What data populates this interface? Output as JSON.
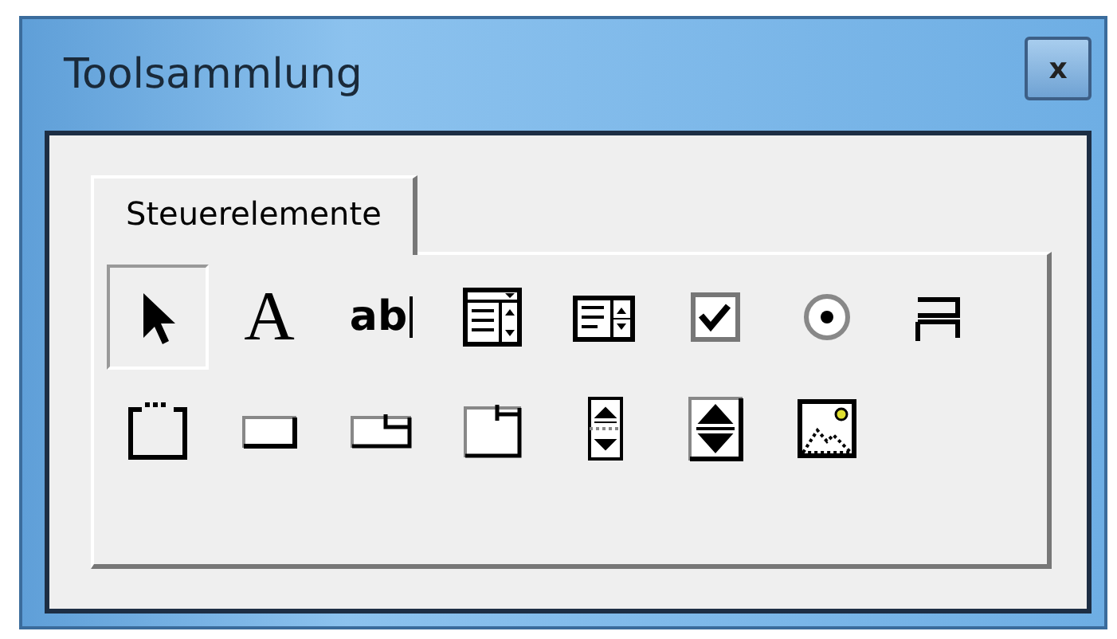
{
  "window": {
    "title": "Toolsammlung",
    "close": "x"
  },
  "tabs": [
    {
      "label": "Steuerelemente",
      "selected": true
    }
  ],
  "tool_rows": [
    [
      {
        "kind": "pointer",
        "selected": true
      },
      {
        "kind": "label",
        "glyph": "A",
        "selected": false
      },
      {
        "kind": "textbox",
        "glyph": "ab",
        "selected": false
      },
      {
        "kind": "combobox",
        "selected": false
      },
      {
        "kind": "listbox",
        "selected": false
      },
      {
        "kind": "checkbox",
        "selected": false
      },
      {
        "kind": "option",
        "selected": false
      },
      {
        "kind": "toggle",
        "selected": false
      }
    ],
    [
      {
        "kind": "frame",
        "selected": false
      },
      {
        "kind": "button",
        "selected": false
      },
      {
        "kind": "tabstrip",
        "selected": false
      },
      {
        "kind": "multipage",
        "selected": false
      },
      {
        "kind": "scrollbar",
        "selected": false
      },
      {
        "kind": "spin",
        "selected": false
      },
      {
        "kind": "image",
        "selected": false
      }
    ]
  ]
}
